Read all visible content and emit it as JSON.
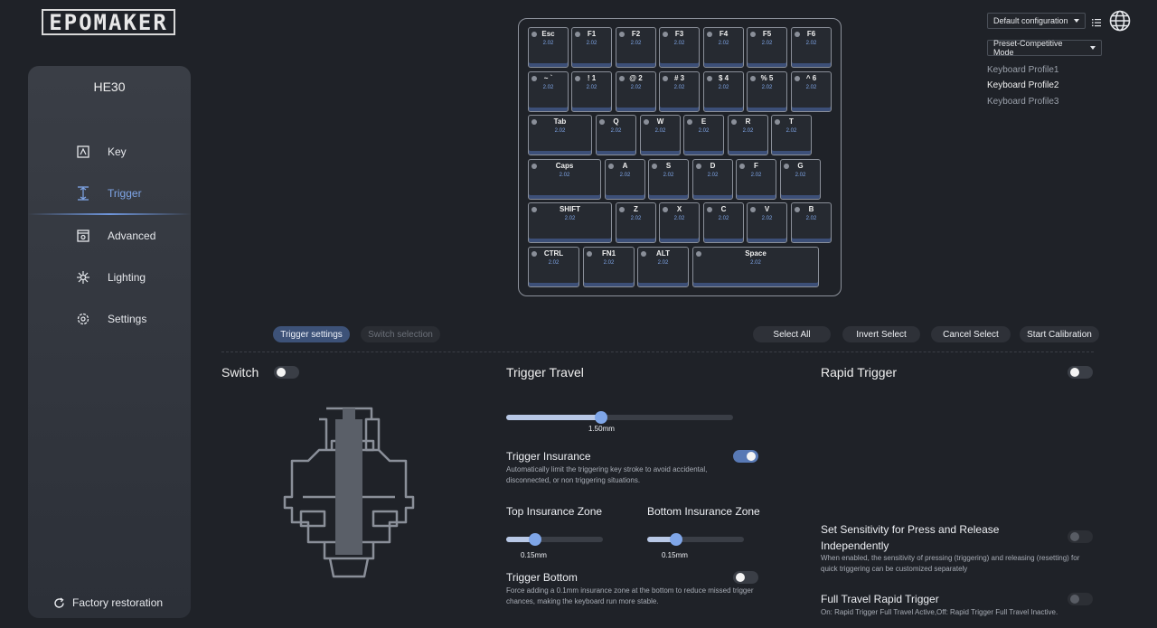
{
  "brand": "EPOMAKER",
  "sidebar": {
    "model": "HE30",
    "items": [
      {
        "label": "Key",
        "icon": "key-icon"
      },
      {
        "label": "Trigger",
        "icon": "trigger-icon"
      },
      {
        "label": "Advanced",
        "icon": "advanced-icon"
      },
      {
        "label": "Lighting",
        "icon": "lighting-icon"
      },
      {
        "label": "Settings",
        "icon": "settings-icon"
      }
    ],
    "active": "Trigger",
    "factory_restoration": "Factory restoration"
  },
  "config": {
    "selected": "Default configuration",
    "mode": "Preset-Competitive Mode",
    "profiles": [
      "Keyboard Profile1",
      "Keyboard Profile2",
      "Keyboard Profile3"
    ],
    "active_profile": "Keyboard Profile2"
  },
  "keyboard": {
    "rows": [
      [
        {
          "label": "Esc",
          "value": "2.02"
        },
        {
          "label": "F1",
          "value": "2.02"
        },
        {
          "label": "F2",
          "value": "2.02"
        },
        {
          "label": "F3",
          "value": "2.02"
        },
        {
          "label": "F4",
          "value": "2.02"
        },
        {
          "label": "F5",
          "value": "2.02"
        },
        {
          "label": "F6",
          "value": "2.02"
        }
      ],
      [
        {
          "label": "~ `",
          "value": "2.02"
        },
        {
          "label": "! 1",
          "value": "2.02"
        },
        {
          "label": "@ 2",
          "value": "2.02"
        },
        {
          "label": "# 3",
          "value": "2.02"
        },
        {
          "label": "$ 4",
          "value": "2.02"
        },
        {
          "label": "% 5",
          "value": "2.02"
        },
        {
          "label": "^ 6",
          "value": "2.02"
        }
      ],
      [
        {
          "label": "Tab",
          "value": "2.02"
        },
        {
          "label": "Q",
          "value": "2.02"
        },
        {
          "label": "W",
          "value": "2.02"
        },
        {
          "label": "E",
          "value": "2.02"
        },
        {
          "label": "R",
          "value": "2.02"
        },
        {
          "label": "T",
          "value": "2.02"
        }
      ],
      [
        {
          "label": "Caps",
          "value": "2.02"
        },
        {
          "label": "A",
          "value": "2.02"
        },
        {
          "label": "S",
          "value": "2.02"
        },
        {
          "label": "D",
          "value": "2.02"
        },
        {
          "label": "F",
          "value": "2.02"
        },
        {
          "label": "G",
          "value": "2.02"
        }
      ],
      [
        {
          "label": "SHIFT",
          "value": "2.02"
        },
        {
          "label": "Z",
          "value": "2.02"
        },
        {
          "label": "X",
          "value": "2.02"
        },
        {
          "label": "C",
          "value": "2.02"
        },
        {
          "label": "V",
          "value": "2.02"
        },
        {
          "label": "B",
          "value": "2.02"
        }
      ],
      [
        {
          "label": "CTRL",
          "value": "2.02"
        },
        {
          "label": "FN1",
          "value": "2.02"
        },
        {
          "label": "ALT",
          "value": "2.02"
        },
        {
          "label": "Space",
          "value": "2.02"
        }
      ]
    ]
  },
  "tabs": {
    "trigger_settings": "Trigger settings",
    "switch_selection": "Switch selection"
  },
  "actions": {
    "select_all": "Select All",
    "invert_select": "Invert Select",
    "cancel_select": "Cancel Select",
    "start_calibration": "Start Calibration"
  },
  "switch": {
    "label": "Switch",
    "enabled": false
  },
  "trigger_travel": {
    "title": "Trigger Travel",
    "value": "1.50mm",
    "fraction": 0.42,
    "insurance": {
      "title": "Trigger Insurance",
      "enabled": true,
      "desc": "Automatically limit the triggering key stroke to avoid accidental, disconnected, or non triggering situations."
    },
    "top_zone": {
      "title": "Top Insurance Zone",
      "value": "0.15mm",
      "fraction": 0.3
    },
    "bottom_zone": {
      "title": "Bottom Insurance Zone",
      "value": "0.15mm",
      "fraction": 0.3
    },
    "bottom": {
      "title": "Trigger Bottom",
      "enabled": false,
      "desc": "Force adding a 0.1mm insurance zone at the bottom to reduce missed trigger chances, making the keyboard run more stable."
    }
  },
  "rapid_trigger": {
    "title": "Rapid Trigger",
    "enabled": false,
    "sensitivity": {
      "title": "Set Sensitivity for Press and Release Independently",
      "enabled": false,
      "desc": "When enabled, the sensitivity of pressing (triggering) and releasing (resetting) for quick triggering can be customized separately"
    },
    "full_travel": {
      "title": "Full Travel Rapid Trigger",
      "enabled": false,
      "desc": "On: Rapid Trigger Full Travel Active,Off: Rapid Trigger Full Travel Inactive."
    }
  },
  "colors": {
    "accent": "#7fa6e8",
    "background": "#1f2228",
    "sidebar": "#33373f"
  }
}
